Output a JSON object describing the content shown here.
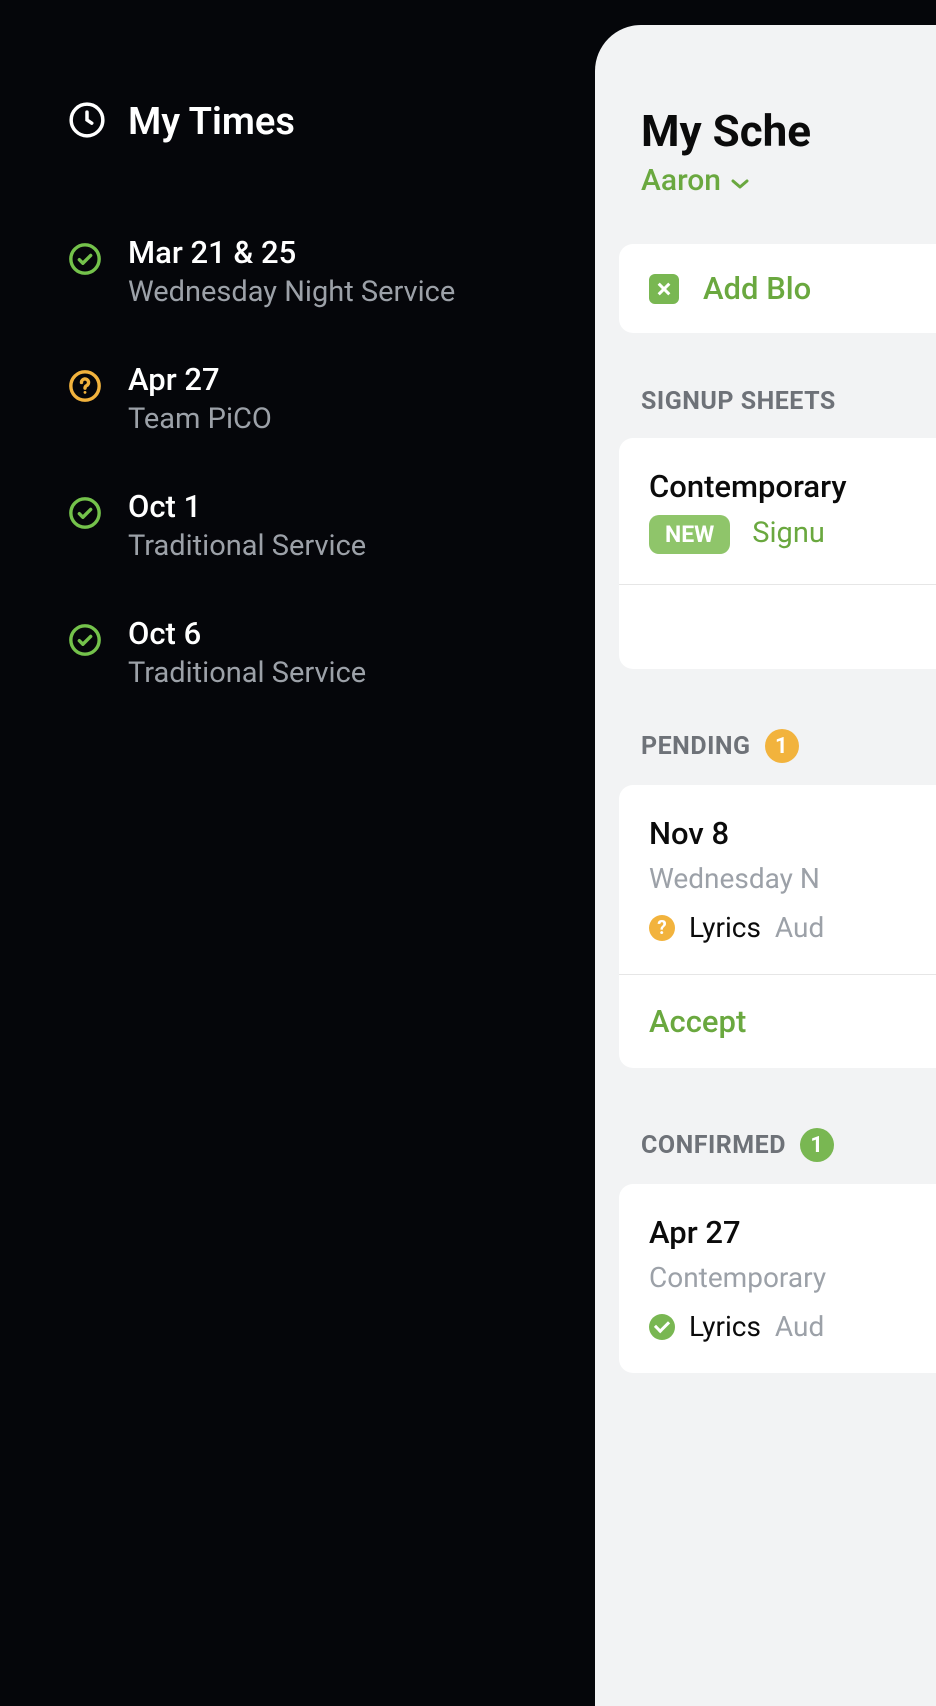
{
  "sidebar": {
    "title": "My Times",
    "items": [
      {
        "date": "Mar 21 & 25",
        "sub": "Wednesday Night Service",
        "status": "confirmed"
      },
      {
        "date": "Apr 27",
        "sub": "Team PiCO",
        "status": "pending"
      },
      {
        "date": "Oct 1",
        "sub": "Traditional Service",
        "status": "confirmed"
      },
      {
        "date": "Oct 6",
        "sub": "Traditional Service",
        "status": "confirmed"
      }
    ]
  },
  "panel": {
    "title": "My Sche",
    "person": "Aaron",
    "add_blockout": "Add Blo",
    "signup": {
      "label": "SIGNUP SHEETS",
      "title": "Contemporary",
      "new": "NEW",
      "link": "Signu"
    },
    "pending": {
      "label": "PENDING",
      "count": "1",
      "date": "Nov 8",
      "sub": "Wednesday N",
      "role": "Lyrics",
      "extra": "Aud",
      "accept": "Accept"
    },
    "confirmed": {
      "label": "CONFIRMED",
      "count": "1",
      "date": "Apr 27",
      "sub": "Contemporary",
      "role": "Lyrics",
      "extra": "Aud"
    }
  }
}
